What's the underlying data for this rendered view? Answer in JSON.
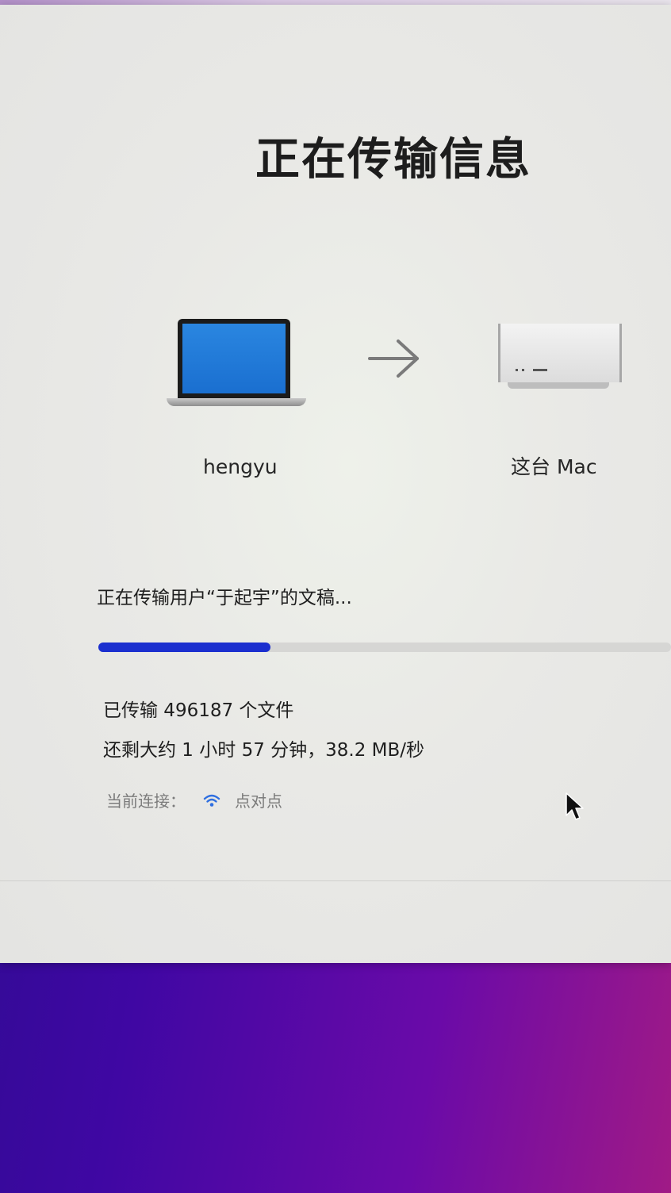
{
  "window": {
    "title": "正在传输信息",
    "source": {
      "name": "hengyu",
      "icon": "laptop-icon"
    },
    "direction_icon": "arrow-right-icon",
    "target": {
      "name": "这台 Mac",
      "icon": "mac-studio-icon"
    },
    "status": "正在传输用户“于起宇”的文稿...",
    "progress": {
      "fraction": 0.3,
      "color": "#1b2fcf"
    },
    "files_transferred": "已传输 496187 个文件",
    "time_remaining": "还剩大约 1 小时 57 分钟，38.2 MB/秒",
    "connection": {
      "label": "当前连接：",
      "icon": "wifi-icon",
      "type": "点对点",
      "icon_color": "#2f6fe0"
    }
  },
  "pointer_icon": "mouse-pointer-icon"
}
